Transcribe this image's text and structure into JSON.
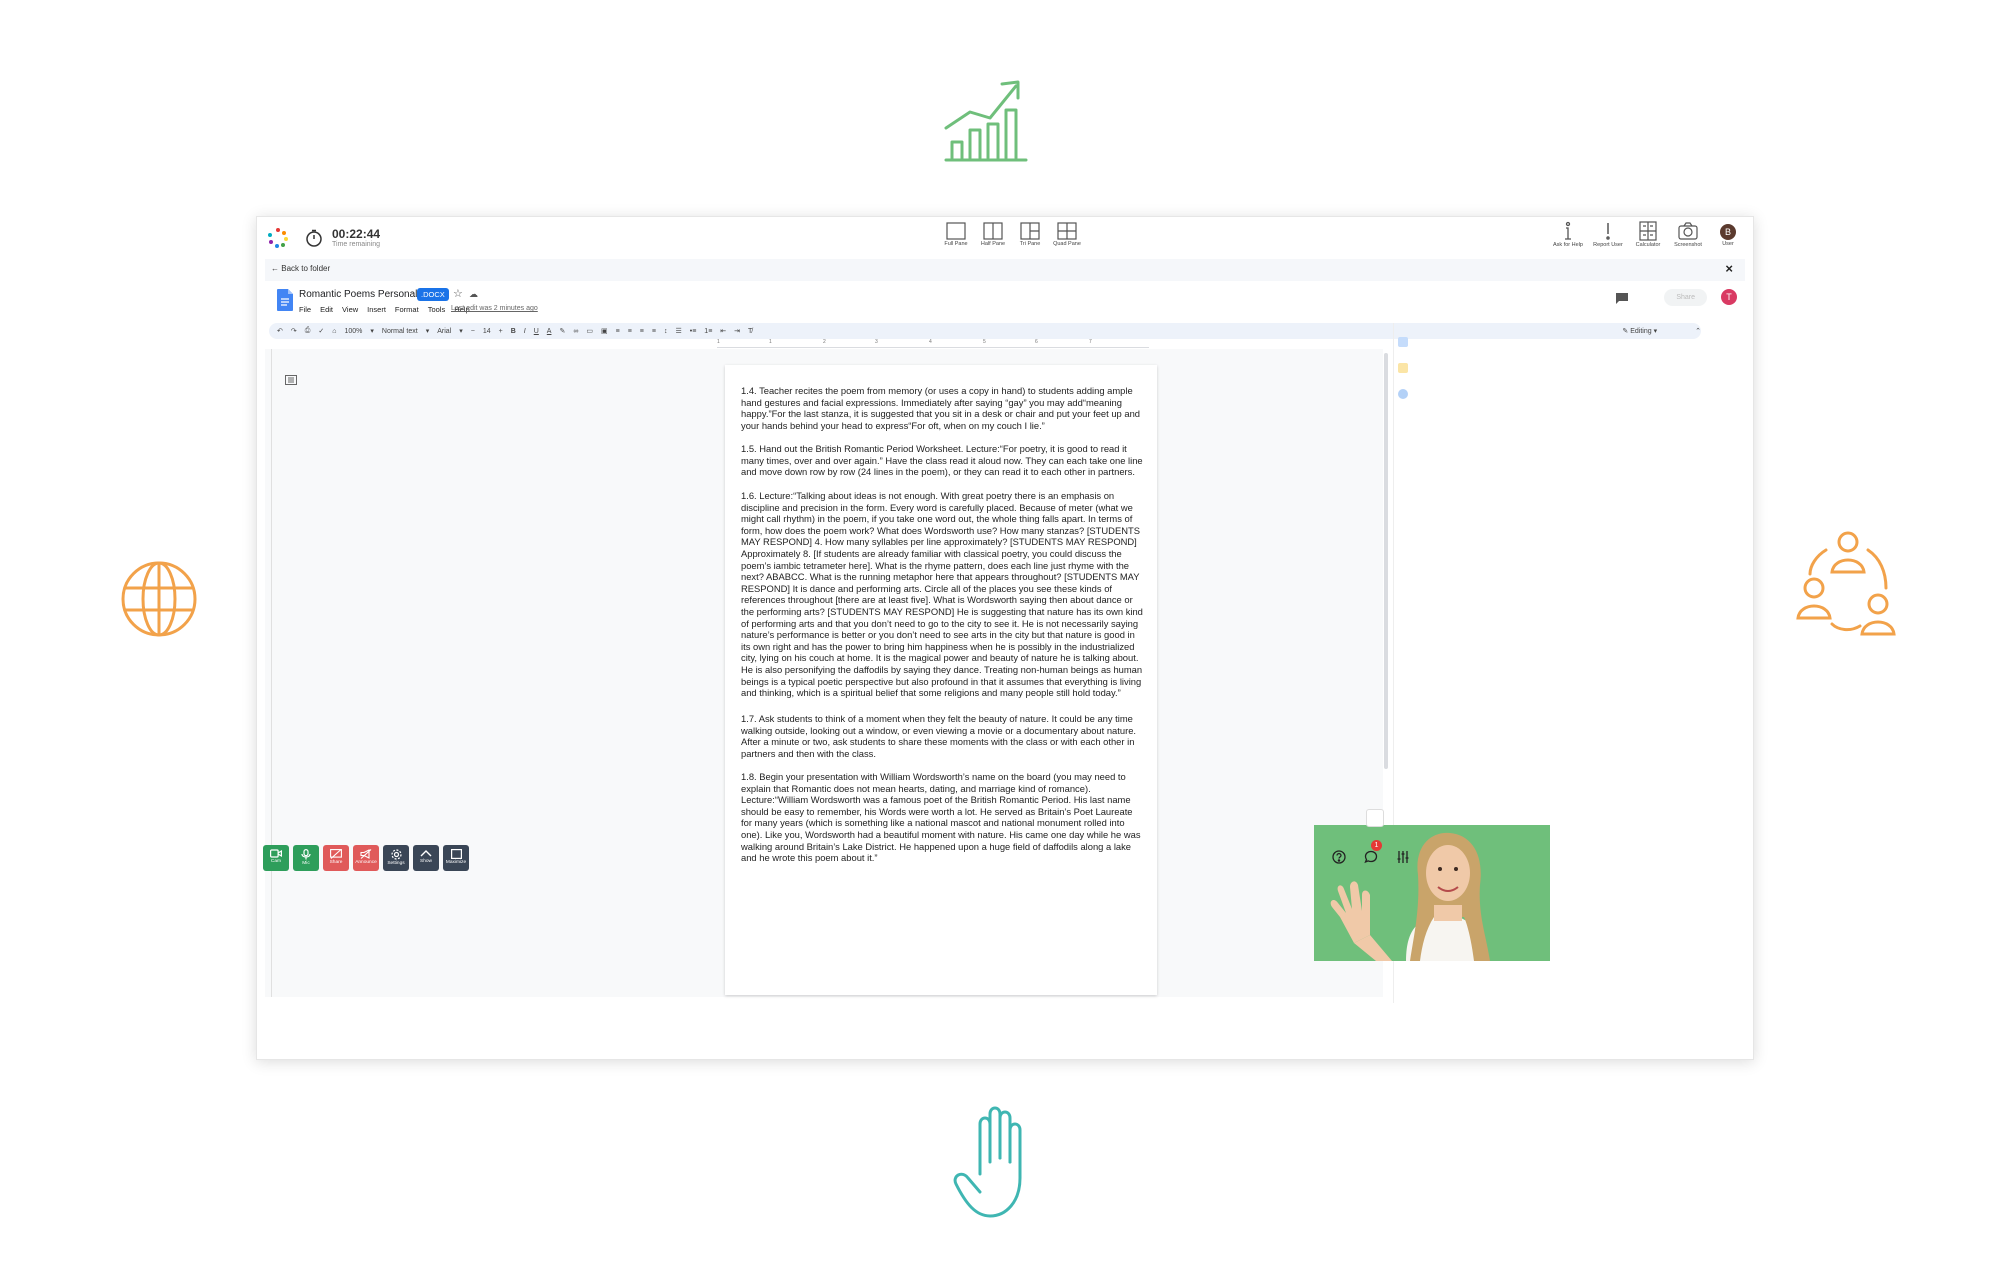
{
  "timer": {
    "value": "00:22:44",
    "label": "Time remaining"
  },
  "panes": [
    {
      "label": "Full Pane"
    },
    {
      "label": "Half Pane"
    },
    {
      "label": "Tri Pane"
    },
    {
      "label": "Quad Pane"
    }
  ],
  "tools": [
    {
      "label": "Ask for Help"
    },
    {
      "label": "Report User"
    },
    {
      "label": "Calculator"
    },
    {
      "label": "Screenshot"
    },
    {
      "label": "User",
      "avatar": "B"
    }
  ],
  "nav": {
    "back_label": "Back to folder",
    "close": "×"
  },
  "doc": {
    "title": "Romantic Poems Personal Task",
    "badge": ".DOCX",
    "menu": [
      "File",
      "Edit",
      "View",
      "Insert",
      "Format",
      "Tools",
      "Help"
    ],
    "last_edit": "Last edit was 2 minutes ago",
    "share_label": "Share",
    "user_avatar": "T"
  },
  "toolbar": {
    "zoom": "100%",
    "style": "Normal text",
    "font": "Arial",
    "size": "14",
    "bold": "B",
    "italic": "I",
    "underline": "U",
    "color": "A",
    "mode": "Editing"
  },
  "ruler": {
    "ticks": [
      "1",
      "1",
      "2",
      "3",
      "4",
      "5",
      "6",
      "7"
    ]
  },
  "paragraphs": [
    "1.4. Teacher recites the poem from memory (or uses a copy in hand) to students adding ample hand gestures and facial expressions. Immediately after saying “gay” you may add“meaning happy.”For the last stanza, it is suggested that you sit in a desk or chair and put your feet up and your hands behind your head to express“For oft, when on my couch I lie.”",
    "1.5. Hand out the British Romantic Period Worksheet. Lecture:“For poetry, it is good to read it many times, over and over again.” Have the class read it aloud now. They can each take one line and move down row by row (24 lines in the poem), or they can read it to each other in partners.",
    "1.6. Lecture:“Talking about ideas is not enough. With great poetry there is an emphasis on discipline and precision in the form. Every word is carefully placed. Because of meter (what we might call rhythm) in the poem, if you take one word out, the whole thing falls apart. In terms of form, how does the poem work? What does Wordsworth use? How many stanzas? [STUDENTS MAY RESPOND] 4. How many syllables per line approximately? [STUDENTS MAY RESPOND] Approximately 8. [If students are already familiar with classical poetry, you could discuss the poem’s iambic tetrameter here]. What is the rhyme pattern, does each line just rhyme with the next? ABABCC. What is the running metaphor here that appears throughout? [STUDENTS MAY RESPOND] It is dance and performing arts. Circle all of the places you see these kinds of references throughout [there are at least five]. What is Wordsworth saying then about dance or the performing arts? [STUDENTS MAY RESPOND] He is suggesting that nature has its own kind of performing arts and that you don’t need to go to the city to see it. He is not necessarily saying nature’s performance is better or you don’t need to see arts in the city but that nature is good in its own right and has the power to bring him happiness when he is possibly in the industrialized city, lying on his couch at home. It is the magical power and beauty of nature he is talking about. He is also personifying the daffodils by saying they dance. Treating non-human beings as human beings is a typical poetic perspective but also profound in that it assumes that everything is living and thinking, which is a spiritual belief that some religions and many people still hold today.”",
    "1.7. Ask students to think of a moment when they felt the beauty of nature. It could be any time walking outside, looking out a window, or even viewing a movie or a documentary about nature. After a minute or two, ask students to share these moments with the class or with each other in partners and then with the class.",
    "1.8. Begin your presentation with William Wordsworth’s name on the board (you may need to explain that Romantic does not mean hearts, dating, and marriage kind of romance). Lecture:“William Wordsworth was a famous poet of the British Romantic Period. His last name should be easy to remember, his Words were worth a lot. He served as Britain’s Poet Laureate for many years (which is something like a national mascot and national monument rolled into one). Like you, Wordsworth had a beautiful moment with nature. His came one day while he was walking around Britain’s Lake District. He happened upon a huge field of daffodils along a lake and he wrote this poem about it.”"
  ],
  "controls": [
    {
      "label": "Cam",
      "color": "#2e9e5b"
    },
    {
      "label": "Mic",
      "color": "#2e9e5b"
    },
    {
      "label": "Share",
      "color": "#e05a5a"
    },
    {
      "label": "Announce",
      "color": "#e05a5a"
    },
    {
      "label": "Settings",
      "color": "#3a4656"
    },
    {
      "label": "Show",
      "color": "#3a4656"
    },
    {
      "label": "Maximize",
      "color": "#3a4656"
    }
  ],
  "notifications": {
    "count": "1"
  },
  "colors": {
    "green_deco": "#6fbf7b",
    "orange_deco": "#f2a24a",
    "teal_deco": "#3fb6b2",
    "accent": "#1a73e8"
  }
}
